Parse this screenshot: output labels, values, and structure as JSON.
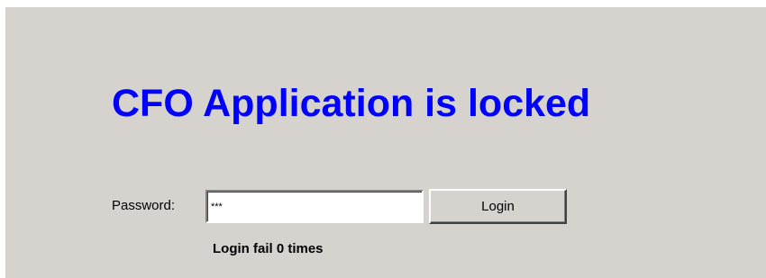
{
  "title": "CFO Application is locked",
  "form": {
    "password_label": "Password:",
    "password_value": "***",
    "login_label": "Login"
  },
  "status": "Login fail 0 times",
  "colors": {
    "title": "#0000ff",
    "panel_background": "#d6d3ce"
  }
}
